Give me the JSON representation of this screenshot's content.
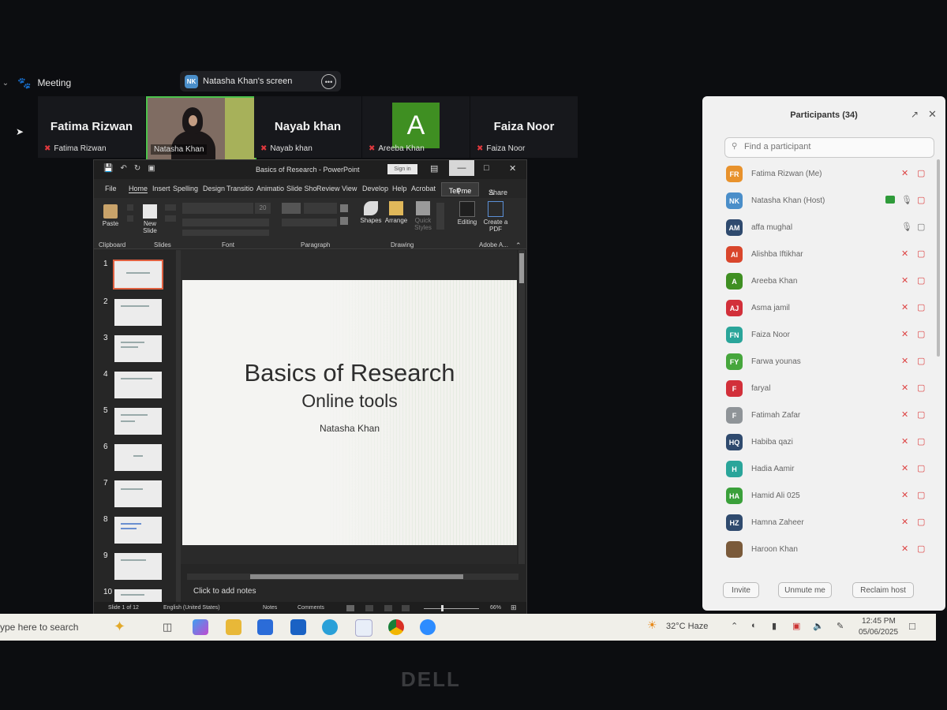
{
  "zoom": {
    "meeting_label": "Meeting",
    "share_initials": "NK",
    "share_label": "Natasha Khan's screen",
    "tiles": [
      {
        "big": "Fatima Rizwan",
        "small": "Fatima Rizwan"
      },
      {
        "small": "Natasha Khan"
      },
      {
        "big": "Nayab khan",
        "small": "Nayab khan"
      },
      {
        "avatar": "A",
        "small": "Areeba Khan"
      },
      {
        "big": "Faiza Noor",
        "small": "Faiza Noor"
      }
    ]
  },
  "ppt": {
    "title": "Basics of Research  -  PowerPoint",
    "sign_in": "Sign in",
    "tabs": [
      "File",
      "Home",
      "Insert",
      "Spelling",
      "Design",
      "Transitio",
      "Animatio",
      "Slide Sho",
      "Review",
      "View",
      "Develop",
      "Help",
      "Acrobat"
    ],
    "tell_me": "Tell me",
    "share": "Share",
    "ribbon": {
      "paste": "Paste",
      "new_slide": "New Slide",
      "shapes": "Shapes",
      "arrange": "Arrange",
      "quick_styles": "Quick Styles",
      "editing": "Editing",
      "create_pdf": "Create a PDF",
      "groups": [
        "Clipboard",
        "Slides",
        "Font",
        "Paragraph",
        "Drawing",
        "Adobe A..."
      ],
      "font_size": "20"
    },
    "thumb_numbers": [
      "1",
      "2",
      "3",
      "4",
      "5",
      "6",
      "7",
      "8",
      "9",
      "10"
    ],
    "slide": {
      "title": "Basics of Research",
      "subtitle": "Online tools",
      "author": "Natasha Khan"
    },
    "notes_placeholder": "Click to add notes",
    "status": {
      "slide_count": "Slide 1 of 12",
      "language": "English (United States)",
      "notes": "Notes",
      "comments": "Comments",
      "zoom": "66%"
    }
  },
  "participants": {
    "title": "Participants (34)",
    "search_placeholder": "Find a participant",
    "list": [
      {
        "initials": "FR",
        "name": "Fatima Rizwan (Me)",
        "color": "#e8922c"
      },
      {
        "initials": "NK",
        "name": "Natasha Khan (Host)",
        "color": "#4a8ec9",
        "host": true
      },
      {
        "initials": "AM",
        "name": "affa mughal",
        "color": "#2f4a6e"
      },
      {
        "initials": "AI",
        "name": "Alishba Iftikhar",
        "color": "#d9462c"
      },
      {
        "initials": "A",
        "name": "Areeba Khan",
        "color": "#3f8f22"
      },
      {
        "initials": "AJ",
        "name": "Asma jamil",
        "color": "#d2303a"
      },
      {
        "initials": "FN",
        "name": "Faiza Noor",
        "color": "#2aa59a"
      },
      {
        "initials": "FY",
        "name": "Farwa younas",
        "color": "#46a63c"
      },
      {
        "initials": "F",
        "name": "faryal",
        "color": "#d2303a"
      },
      {
        "initials": "F",
        "name": "Fatimah Zafar",
        "color": "#8f9498"
      },
      {
        "initials": "HQ",
        "name": "Habiba qazi",
        "color": "#2f4a6e"
      },
      {
        "initials": "H",
        "name": "Hadia Aamir",
        "color": "#2aa59a"
      },
      {
        "initials": "HA",
        "name": "Hamid Ali 025",
        "color": "#3aa03a"
      },
      {
        "initials": "HZ",
        "name": "Hamna Zaheer",
        "color": "#2f4a6e"
      },
      {
        "initials": "",
        "name": "Haroon Khan",
        "color": "#7a5a3a"
      }
    ],
    "buttons": {
      "invite": "Invite",
      "unmute": "Unmute me",
      "reclaim": "Reclaim host"
    }
  },
  "taskbar": {
    "search": "ype here to search",
    "weather": "32°C  Haze",
    "time": "12:45 PM",
    "date": "05/06/2025"
  },
  "bezel_brand": "DELL"
}
